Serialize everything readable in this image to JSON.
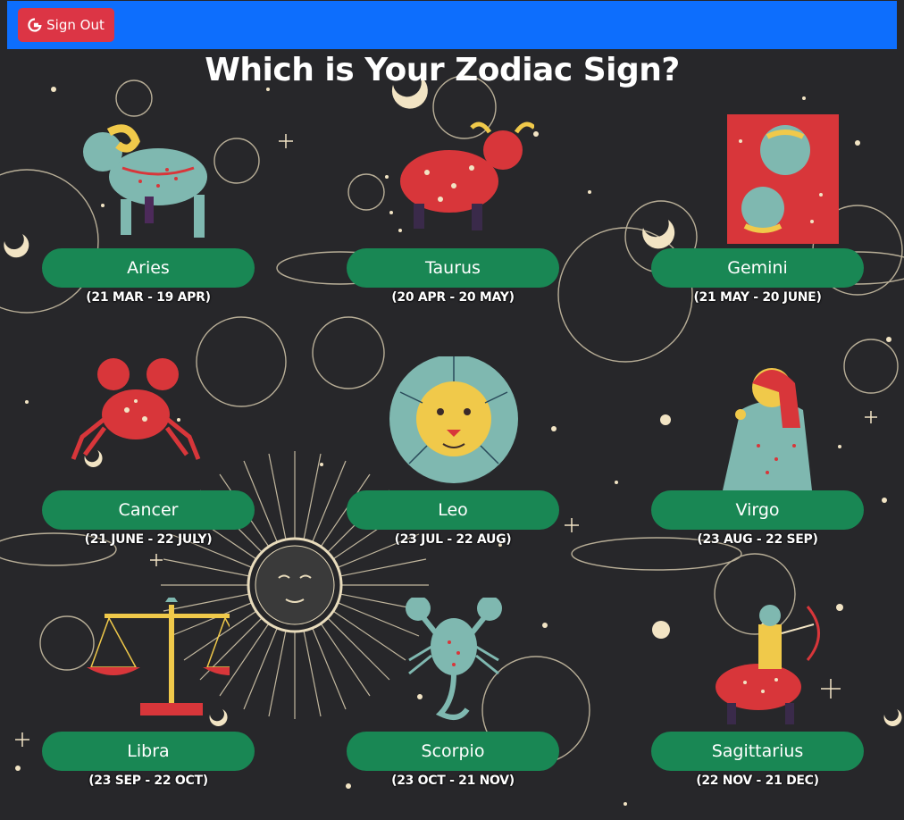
{
  "navbar": {
    "signout_label": "Sign Out",
    "color": "#0d6efd",
    "signout_color": "#dc3545"
  },
  "page": {
    "title": "Which is Your Zodiac Sign?",
    "background": "#27272a"
  },
  "signs": [
    {
      "name": "Aries",
      "dates": "(21 MAR - 19 APR)",
      "icon": "ram-icon"
    },
    {
      "name": "Taurus",
      "dates": "(20 APR - 20 MAY)",
      "icon": "bull-icon"
    },
    {
      "name": "Gemini",
      "dates": "(21 MAY - 20 JUNE)",
      "icon": "twins-icon"
    },
    {
      "name": "Cancer",
      "dates": "(21 JUNE - 22 JULY)",
      "icon": "crab-icon"
    },
    {
      "name": "Leo",
      "dates": "(23 JUL - 22 AUG)",
      "icon": "lion-icon"
    },
    {
      "name": "Virgo",
      "dates": "(23 AUG - 22 SEP)",
      "icon": "maiden-icon"
    },
    {
      "name": "Libra",
      "dates": "(23 SEP - 22 OCT)",
      "icon": "scales-icon"
    },
    {
      "name": "Scorpio",
      "dates": "(23 OCT - 21 NOV)",
      "icon": "scorpion-icon"
    },
    {
      "name": "Sagittarius",
      "dates": "(22 NOV - 21 DEC)",
      "icon": "archer-icon"
    }
  ],
  "colors": {
    "sign_button": "#198754",
    "accent_red": "#d8363a",
    "accent_teal": "#7fb8b0",
    "accent_yellow": "#f0c94a",
    "cream": "#f2e4c4"
  }
}
